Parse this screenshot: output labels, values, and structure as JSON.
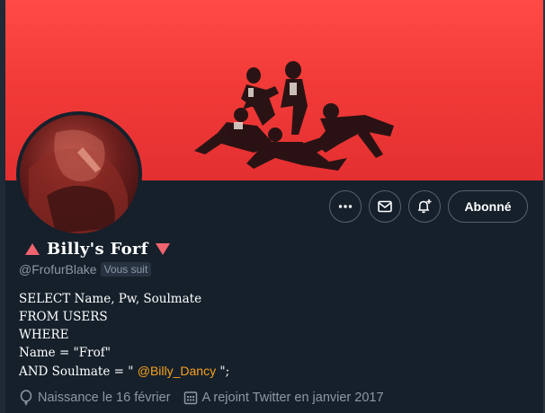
{
  "profile": {
    "display_name": "Billy's Forf",
    "handle": "@FrofurBlake",
    "follows_you_badge": "Vous suit",
    "bio_lines": {
      "line1": "SELECT Name, Pw, Soulmate",
      "line2": "FROM USERS",
      "line3": "WHERE",
      "line4": "Name = \"Frof\"",
      "line5_prefix": "AND Soulmate = \" ",
      "line5_mention": "@Billy_Dancy",
      "line5_suffix": " \";"
    },
    "birth": "Naissance le 16 février",
    "joined": "A rejoint Twitter en janvier 2017"
  },
  "actions": {
    "more_icon": "more-horizontal-icon",
    "message_icon": "envelope-icon",
    "notify_icon": "bell-plus-icon",
    "follow_label": "Abonné"
  },
  "icons": {
    "name_left": "triangle-up-icon",
    "name_right": "triangle-down-icon",
    "birth": "balloon-icon",
    "joined": "calendar-icon"
  },
  "colors": {
    "background": "#15202b",
    "banner_red": "#f23b38",
    "accent_mention": "#f7a11e",
    "triangle_pink": "#f0646f",
    "muted_text": "#8b98a5"
  }
}
